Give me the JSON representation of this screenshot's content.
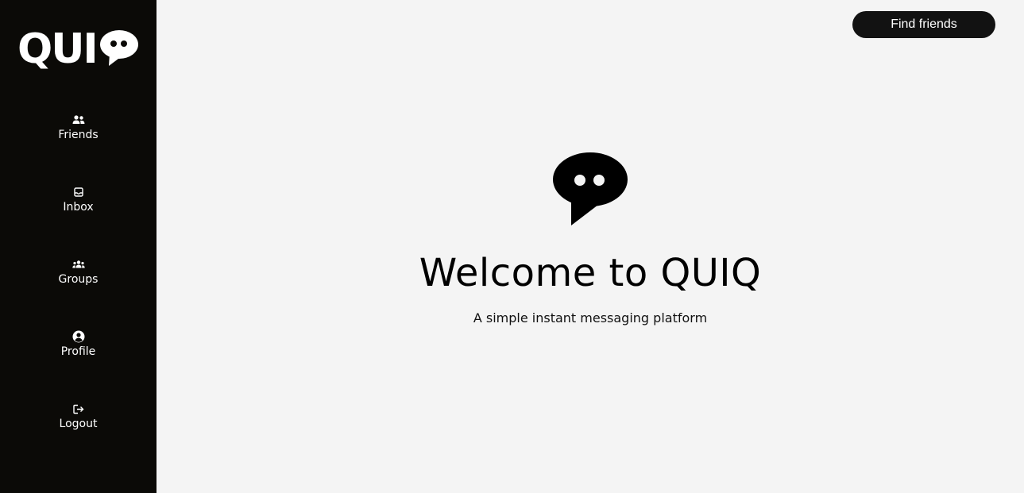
{
  "sidebar": {
    "logo_text": "QUI",
    "nav": [
      {
        "label": "Friends",
        "icon": "friends-icon"
      },
      {
        "label": "Inbox",
        "icon": "inbox-icon"
      },
      {
        "label": "Groups",
        "icon": "groups-icon"
      },
      {
        "label": "Profile",
        "icon": "profile-icon"
      },
      {
        "label": "Logout",
        "icon": "logout-icon"
      }
    ]
  },
  "header": {
    "find_friends_label": "Find friends"
  },
  "hero": {
    "icon": "chat-bubble-icon",
    "title": "Welcome to QUIQ",
    "subtitle": "A simple instant messaging platform"
  },
  "colors": {
    "sidebar_bg": "#0b0a07",
    "main_bg": "#f4f4f4",
    "button_bg": "#121212",
    "text_light": "#ffffff",
    "text_dark": "#000000"
  }
}
